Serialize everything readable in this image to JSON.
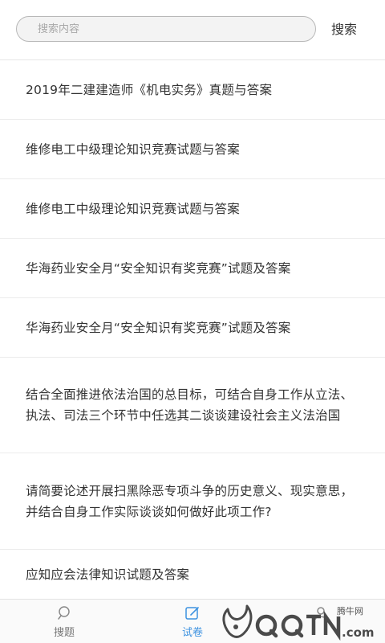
{
  "search": {
    "placeholder": "搜索内容",
    "value": "",
    "button_label": "搜索"
  },
  "items": [
    {
      "title": "2019年二建建造师《机电实务》真题与答案"
    },
    {
      "title": "维修电工中级理论知识竞赛试题与答案"
    },
    {
      "title": "维修电工中级理论知识竞赛试题与答案"
    },
    {
      "title": "华海药业安全月“安全知识有奖竞赛”试题及答案"
    },
    {
      "title": "华海药业安全月“安全知识有奖竞赛”试题及答案"
    },
    {
      "title": "结合全面推进依法治国的总目标，可结合自身工作从立法、执法、司法三个环节中任选其二谈谈建设社会主义法治国"
    },
    {
      "title": "请简要论述开展扫黑除恶专项斗争的历史意义、现实意思，并结合自身工作实际谈谈如何做好此项工作?"
    },
    {
      "title": "应知应会法律知识试题及答案"
    }
  ],
  "bottom_nav": {
    "items": [
      {
        "label": "搜题",
        "icon": "search-icon",
        "active": false
      },
      {
        "label": "试卷",
        "icon": "edit-icon",
        "active": true
      },
      {
        "label": "",
        "icon": "user-icon",
        "active": false
      }
    ]
  },
  "watermark": {
    "brand": "腾牛网",
    "logo_text": "QQTN.com"
  },
  "colors": {
    "accent": "#3d92e0",
    "text": "#333333",
    "muted": "#777777",
    "divider": "#ececec"
  }
}
